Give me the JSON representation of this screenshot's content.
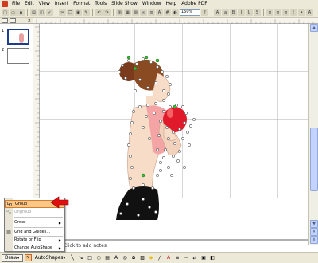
{
  "menubar": {
    "items": [
      "File",
      "Edit",
      "View",
      "Insert",
      "Format",
      "Tools",
      "Slide Show",
      "Window",
      "Help",
      "Adobe PDF"
    ]
  },
  "toolbar": {
    "zoom": "150%"
  },
  "slides_panel": {
    "slides": [
      {
        "number": "1",
        "selected": true
      },
      {
        "number": "2",
        "selected": false
      }
    ]
  },
  "notes": {
    "placeholder": "Click to add notes"
  },
  "drawing_toolbar": {
    "draw_label": "Draw",
    "autoshapes_label": "AutoShapes"
  },
  "draw_menu": {
    "items": [
      {
        "label": "Group",
        "state": "highlighted"
      },
      {
        "label": "Ungroup",
        "state": "disabled"
      },
      {
        "label": "Order",
        "submenu": true
      },
      {
        "label": "Grid and Guides...",
        "submenu": false
      },
      {
        "label": "Rotate or Flip",
        "submenu": true
      },
      {
        "label": "Change AutoShape",
        "submenu": true
      }
    ]
  },
  "colors": {
    "chrome": "#ece9d8",
    "menu_highlight": "#f9c886",
    "annotation_arrow": "#e01010"
  }
}
